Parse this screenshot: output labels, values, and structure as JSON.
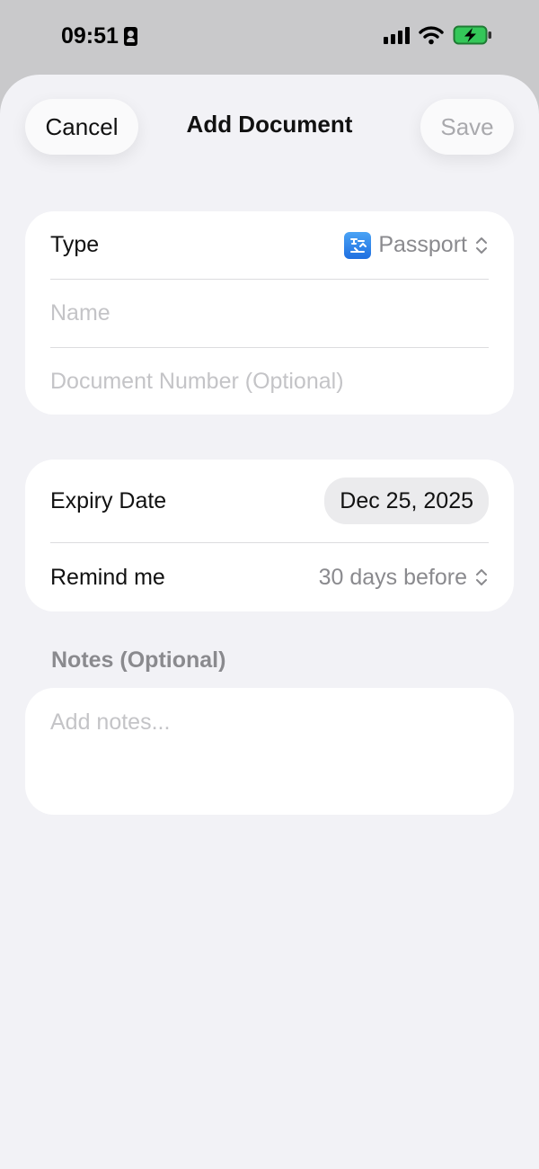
{
  "status_bar": {
    "time": "09:51"
  },
  "nav": {
    "cancel": "Cancel",
    "title": "Add Document",
    "save": "Save"
  },
  "form": {
    "type_label": "Type",
    "type_value": "Passport",
    "name_placeholder": "Name",
    "doc_number_placeholder": "Document Number (Optional)",
    "expiry_label": "Expiry Date",
    "expiry_value": "Dec 25, 2025",
    "remind_label": "Remind me",
    "remind_value": "30 days before",
    "notes_header": "Notes (Optional)",
    "notes_placeholder": "Add notes..."
  },
  "icons": {
    "type": "passport-control-icon",
    "chevrons": "chevron-up-down-icon",
    "status": [
      "contact-card-icon",
      "cellular-signal-icon",
      "wifi-icon",
      "battery-charging-icon"
    ]
  },
  "colors": {
    "battery": "#34c759",
    "save_disabled": "#a9a9ad",
    "placeholder": "#c4c4c7"
  }
}
